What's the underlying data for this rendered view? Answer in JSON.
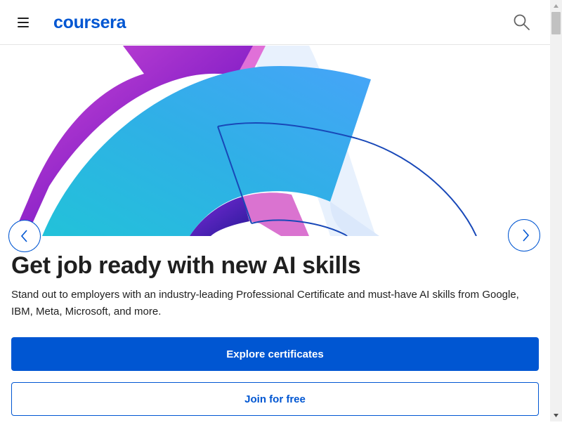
{
  "header": {
    "logo_text": "coursera",
    "menu_icon": "hamburger-menu-icon",
    "search_icon": "search-icon"
  },
  "hero": {
    "illustration": "abstract-arc-illustration",
    "prev_icon": "chevron-left-icon",
    "next_icon": "chevron-right-icon"
  },
  "content": {
    "headline": "Get job ready with new AI skills",
    "description": "Stand out to employers with an industry-leading Professional Certificate and must-have AI skills from Google, IBM, Meta, Microsoft, and more.",
    "primary_button": "Explore certificates",
    "secondary_button": "Join for free"
  },
  "colors": {
    "brand": "#0056d2",
    "text": "#1f1f1f",
    "border": "#e5e5e5"
  }
}
